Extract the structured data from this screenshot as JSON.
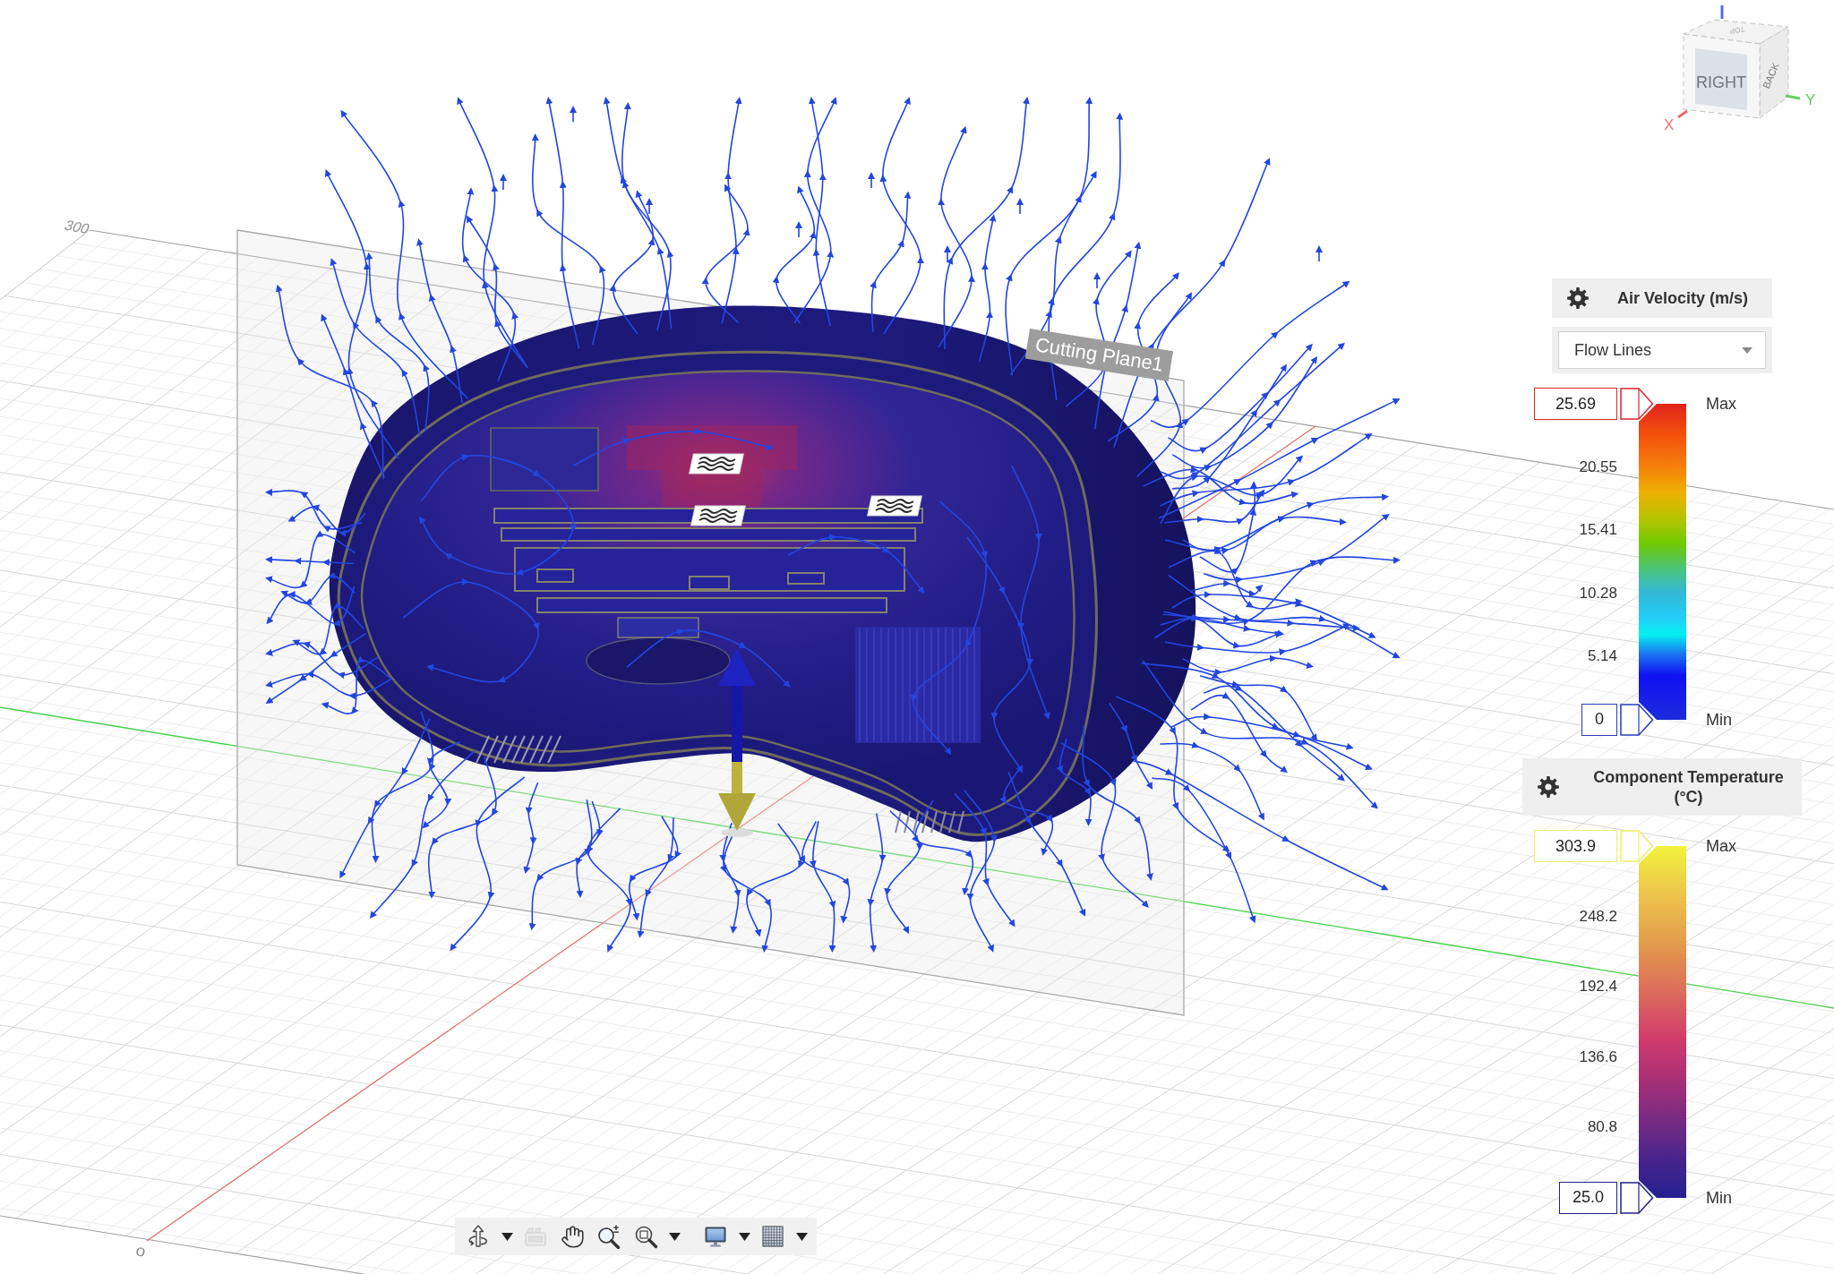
{
  "scene": {
    "grid_labels": [
      "300",
      "0"
    ],
    "cutting_plane": {
      "label": "Cutting Plane1"
    }
  },
  "view_cube": {
    "faces": {
      "front": "RIGHT",
      "side": "BACK",
      "top": "TOP"
    },
    "axes": {
      "x": "X",
      "y": "Y"
    }
  },
  "legends": [
    {
      "kind": "rainbow",
      "title": "Air Velocity (m/s)",
      "dropdown": {
        "value": "Flow Lines"
      },
      "max": "25.69",
      "ticks": [
        "20.55",
        "15.41",
        "10.28",
        "5.14"
      ],
      "min": "0",
      "max_label": "Max",
      "min_label": "Min"
    },
    {
      "kind": "plasma",
      "title": "Component Temperature (°C)",
      "max": "303.9",
      "ticks": [
        "248.2",
        "192.4",
        "136.6",
        "80.8"
      ],
      "min": "25.0",
      "max_label": "Max",
      "min_label": "Min"
    }
  ],
  "toolbar": [
    {
      "kind": "orbit",
      "disabled": false,
      "menu": true
    },
    {
      "kind": "look_at",
      "disabled": true,
      "menu": false
    },
    {
      "kind": "pan",
      "disabled": false,
      "menu": false
    },
    {
      "kind": "zoom",
      "disabled": false,
      "menu": false
    },
    {
      "kind": "window_zoom",
      "disabled": false,
      "menu": true
    },
    {
      "kind": "display",
      "disabled": false,
      "menu": true
    },
    {
      "kind": "grid",
      "disabled": false,
      "menu": true
    }
  ]
}
